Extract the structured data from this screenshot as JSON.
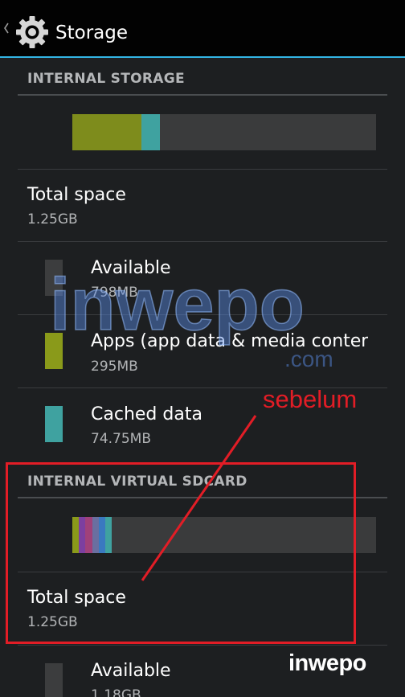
{
  "action_bar": {
    "title": "Storage",
    "accent_color": "#33b5e5"
  },
  "internal_storage": {
    "header": "INTERNAL STORAGE",
    "usage_fractions": {
      "apps": 0.23,
      "cached": 0.06
    },
    "total": {
      "label": "Total space",
      "value": "1.25GB"
    },
    "items": [
      {
        "label": "Available",
        "value": "798MB",
        "color": "#3c3d3e"
      },
      {
        "label": "Apps (app data & media content)",
        "value": "295MB",
        "color": "#8a9a1a"
      },
      {
        "label": "Cached data",
        "value": "74.75MB",
        "color": "#3fa2a0"
      }
    ]
  },
  "internal_virtual_sdcard": {
    "header": "INTERNAL VIRTUAL SDCARD",
    "usage_colors": [
      "#8a9a1a",
      "#7c3fa0",
      "#a0417a",
      "#6a6fa0",
      "#3a79c0",
      "#3fa2a0"
    ],
    "total": {
      "label": "Total space",
      "value": "1.25GB"
    },
    "items": [
      {
        "label": "Available",
        "value": "1.18GB",
        "color": "#3c3d3e"
      }
    ]
  },
  "annotation": {
    "text": "sebelum",
    "color": "#e21d26"
  },
  "watermark": {
    "brand": "inwepo",
    "domain": ".com"
  }
}
